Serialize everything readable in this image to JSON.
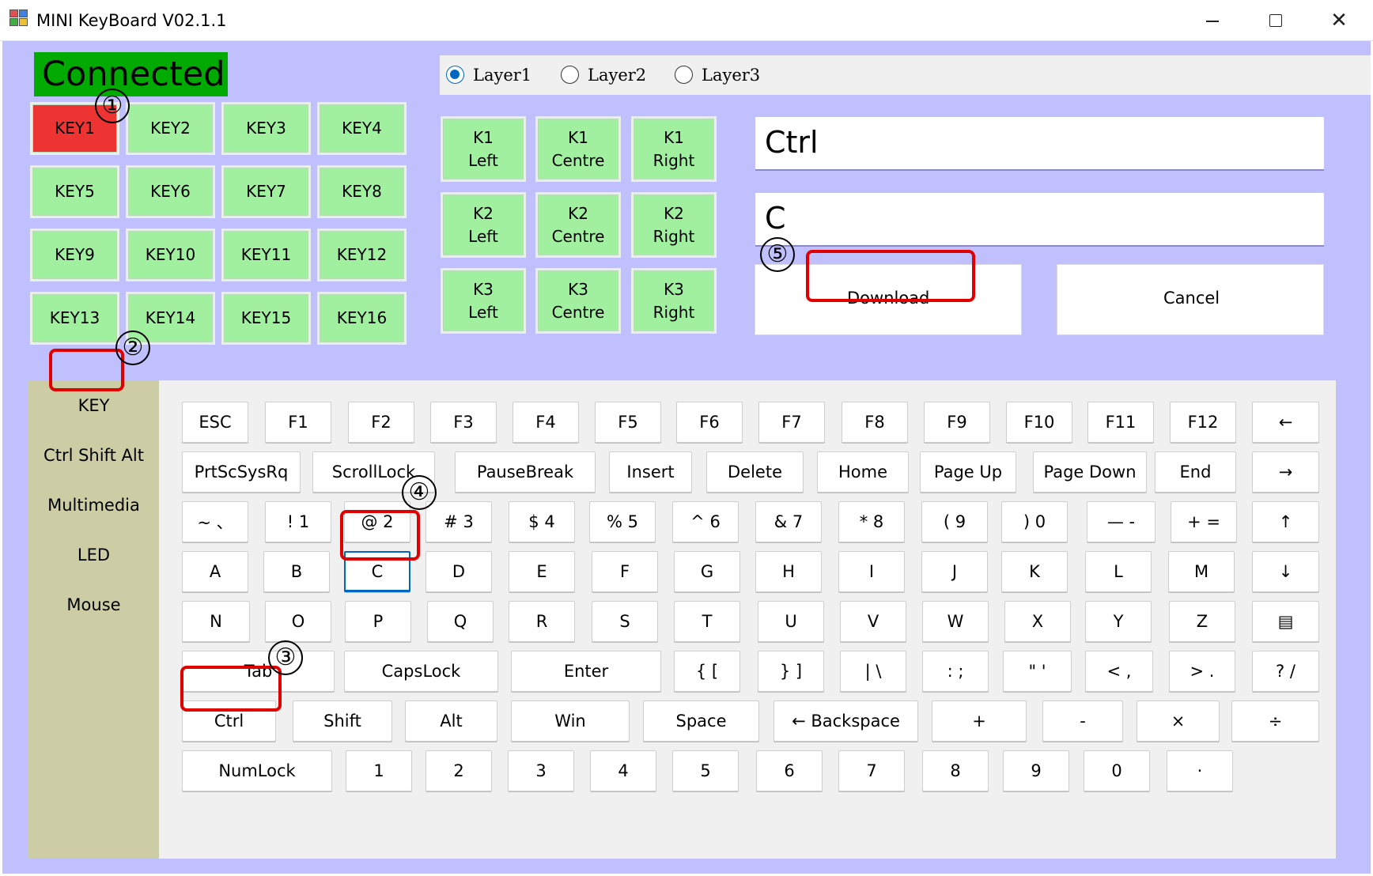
{
  "window": {
    "title": "MINI KeyBoard V02.1.1",
    "minimize": "",
    "maximize": "",
    "close": "✕"
  },
  "status": "Connected",
  "layers": [
    {
      "label": "Layer1",
      "selected": true
    },
    {
      "label": "Layer2",
      "selected": false
    },
    {
      "label": "Layer3",
      "selected": false
    }
  ],
  "key_grid": [
    "KEY1",
    "KEY2",
    "KEY3",
    "KEY4",
    "KEY5",
    "KEY6",
    "KEY7",
    "KEY8",
    "KEY9",
    "KEY10",
    "KEY11",
    "KEY12",
    "KEY13",
    "KEY14",
    "KEY15",
    "KEY16"
  ],
  "key_grid_active": "KEY1",
  "knobs": [
    "K1\nLeft",
    "K1\nCentre",
    "K1\nRight",
    "K2\nLeft",
    "K2\nCentre",
    "K2\nRight",
    "K3\nLeft",
    "K3\nCentre",
    "K3\nRight"
  ],
  "fields": {
    "modifier": "Ctrl",
    "key": "C"
  },
  "buttons": {
    "download": "Download",
    "cancel": "Cancel"
  },
  "sidebar": [
    "KEY",
    "Ctrl Shift Alt",
    "Multimedia",
    "LED",
    "Mouse"
  ],
  "keyboard_rows": [
    [
      "ESC",
      "F1",
      "F2",
      "F3",
      "F4",
      "F5",
      "F6",
      "F7",
      "F8",
      "F9",
      "F10",
      "F11",
      "F12",
      "←"
    ],
    [
      "PrtScSysRq",
      "ScrollLock",
      "PauseBreak",
      "Insert",
      "Delete",
      "Home",
      "Page Up",
      "Page Down",
      "End",
      "→"
    ],
    [
      "~ 、",
      "! 1",
      "@ 2",
      "# 3",
      "$ 4",
      "% 5",
      "^ 6",
      "& 7",
      "* 8",
      "( 9",
      ") 0",
      "— -",
      "+ =",
      "↑"
    ],
    [
      "A",
      "B",
      "C",
      "D",
      "E",
      "F",
      "G",
      "H",
      "I",
      "J",
      "K",
      "L",
      "M",
      "↓"
    ],
    [
      "N",
      "O",
      "P",
      "Q",
      "R",
      "S",
      "T",
      "U",
      "V",
      "W",
      "X",
      "Y",
      "Z",
      "▤"
    ],
    [
      "Tab",
      "CapsLock",
      "Enter",
      "{ [",
      "} ]",
      "| \\",
      ": ;",
      "\" '",
      "< ,",
      "> .",
      "? /"
    ],
    [
      "Ctrl",
      "Shift",
      "Alt",
      "Win",
      "Space",
      "← Backspace",
      "+",
      "-",
      "×",
      "÷"
    ],
    [
      "NumLock",
      "1",
      "2",
      "3",
      "4",
      "5",
      "6",
      "7",
      "8",
      "9",
      "0",
      "·"
    ]
  ],
  "selected_key": "C",
  "annotations": [
    "①",
    "②",
    "③",
    "④",
    "⑤"
  ],
  "colors": {
    "background": "#c0c0ff",
    "status": "#00aa00",
    "key_green": "#a0f0a0",
    "key_active": "#ee3333",
    "highlight": "#e00000",
    "sidebar": "#cccca5"
  }
}
